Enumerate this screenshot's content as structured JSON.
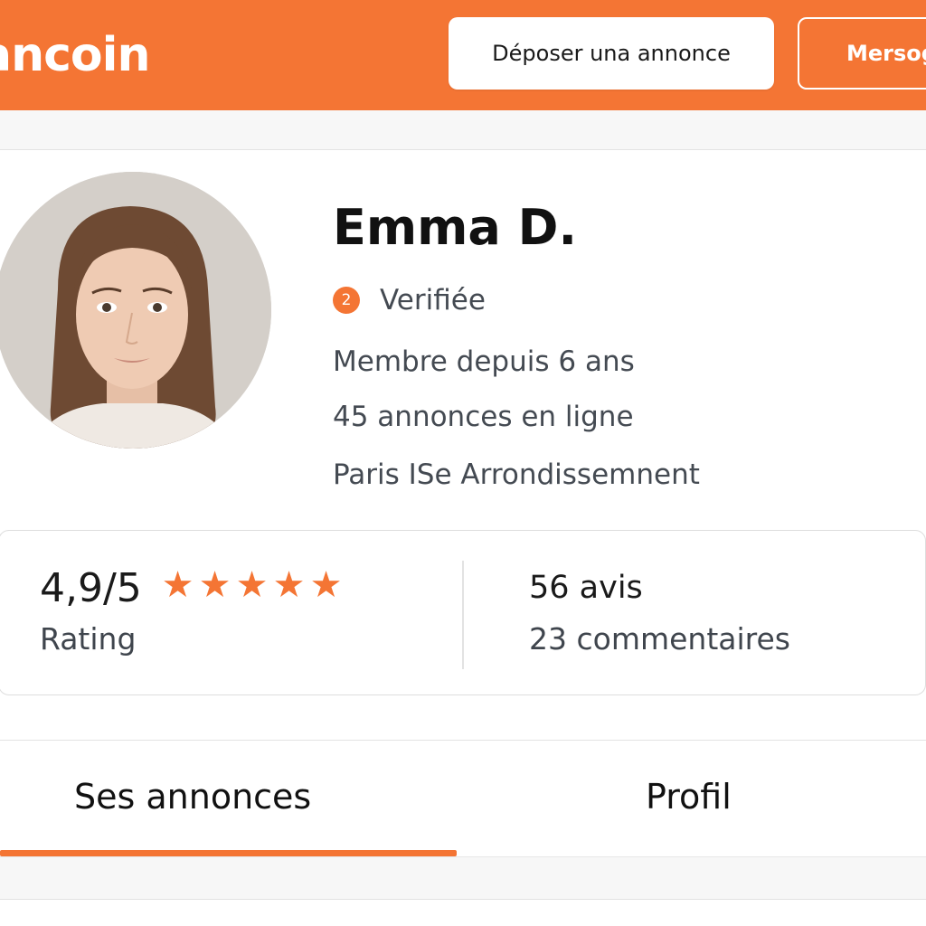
{
  "header": {
    "logo_text": "ancoin",
    "deposit_button_label": "Déposer una annonce",
    "messages_button_label": "Mersog"
  },
  "profile": {
    "name": "Emma D.",
    "verified_badge": "2",
    "verified_label": "Verifiée",
    "member_since": "Membre depuis 6 ans",
    "listings_online": "45 annonces en ligne",
    "location": "Paris ISe Arrondissemnent",
    "avatar_icon": "avatar-photo"
  },
  "stats": {
    "rating_value": "4,9/5",
    "rating_stars": 5,
    "rating_label": "Rating",
    "reviews": "56 avis",
    "comments": "23 commentaires"
  },
  "tabs": [
    {
      "label": "Ses annonces",
      "active": true
    },
    {
      "label": "Profil",
      "active": false
    }
  ],
  "colors": {
    "accent": "#f47534",
    "text_primary": "#111111",
    "text_secondary": "#444a52"
  }
}
